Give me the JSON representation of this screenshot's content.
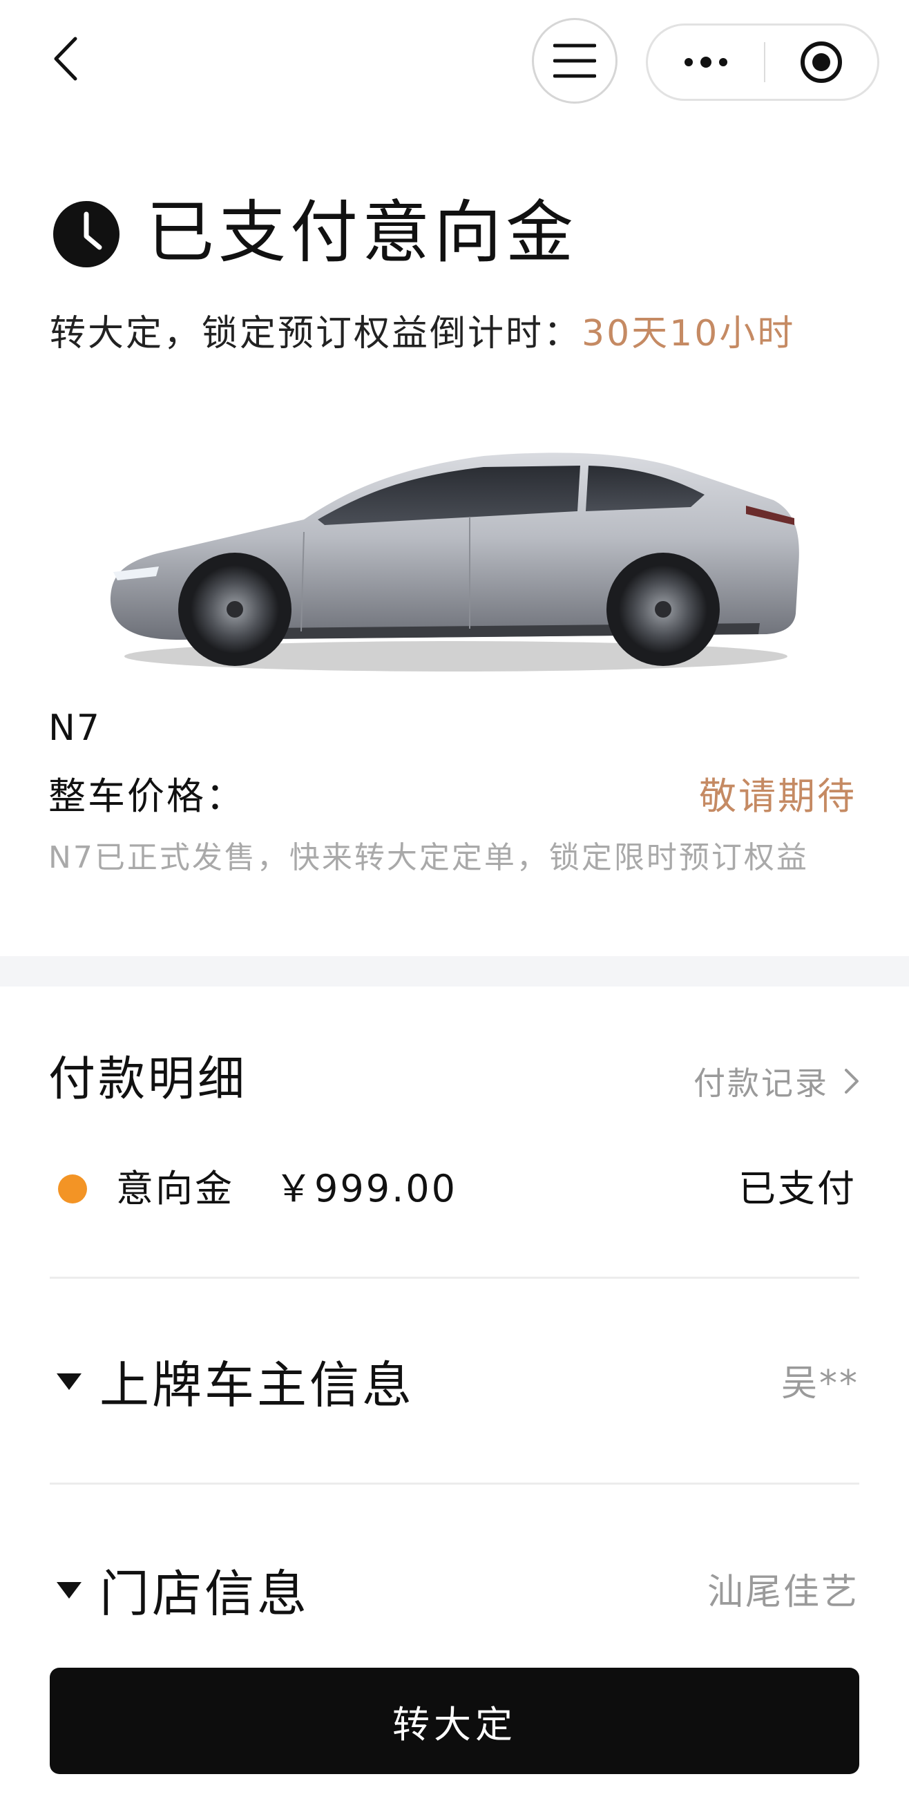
{
  "topbar": {
    "back_icon": "chevron-left-icon",
    "menu_icon": "hamburger-menu-icon",
    "more_icon": "more-dots-icon",
    "close_icon": "target-circle-icon"
  },
  "status": {
    "icon": "clock-icon",
    "title": "已支付意向金",
    "countdown_label": "转大定，锁定预订权益倒计时：",
    "countdown_value": "30天10小时"
  },
  "car": {
    "model": "N7",
    "price_label": "整车价格：",
    "price_value": "敬请期待",
    "notice": "N7已正式发售，快来转大定定单，锁定限时预订权益"
  },
  "payment": {
    "title": "付款明细",
    "records_link": "付款记录",
    "items": [
      {
        "label": "意向金",
        "amount": "￥999.00",
        "status": "已支付"
      }
    ]
  },
  "owner_info": {
    "title": "上牌车主信息",
    "value": "吴**"
  },
  "store_info": {
    "title": "门店信息",
    "value": "汕尾佳艺"
  },
  "cta": {
    "label": "转大定"
  },
  "colors": {
    "accent": "#c58a63",
    "deposit_dot": "#f39425",
    "cta_background": "#0d0d0d"
  }
}
